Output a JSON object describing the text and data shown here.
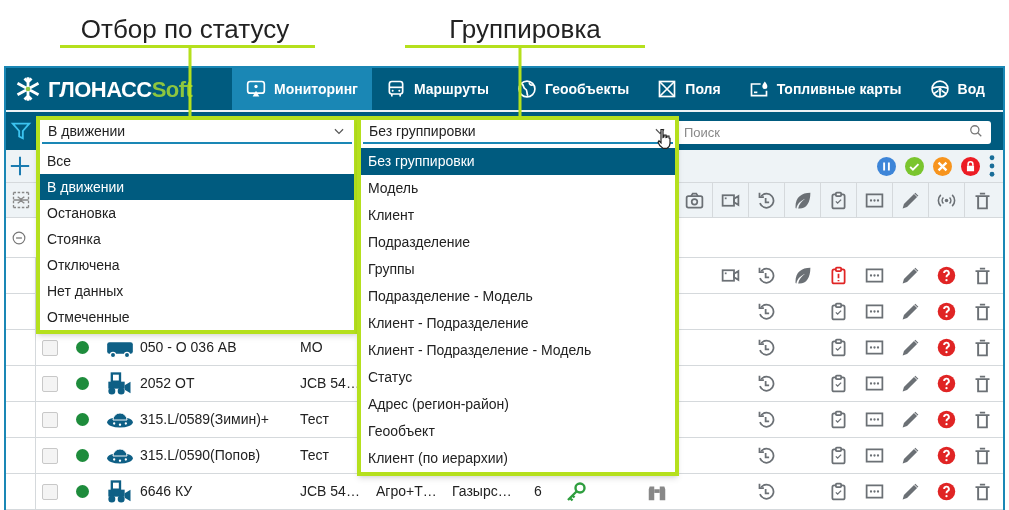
{
  "callouts": [
    {
      "text": "Отбор по статусу"
    },
    {
      "text": "Группировка"
    }
  ],
  "logo": {
    "main": "ГЛОНАСС",
    "accent": "Soft"
  },
  "nav": [
    {
      "label": "Мониторинг",
      "kind": "screen",
      "selected": true
    },
    {
      "label": "Маршруты",
      "kind": "bus",
      "selected": false
    },
    {
      "label": "Геообъекты",
      "kind": "globe",
      "selected": false
    },
    {
      "label": "Поля",
      "kind": "field",
      "selected": false
    },
    {
      "label": "Топливные карты",
      "kind": "fuel",
      "selected": false
    },
    {
      "label": "Вод",
      "kind": "wheel",
      "selected": false
    }
  ],
  "status_filter": {
    "value": "В движении",
    "options": [
      {
        "label": "Все",
        "selected": false
      },
      {
        "label": "В движении",
        "selected": true
      },
      {
        "label": "Остановка",
        "selected": false
      },
      {
        "label": "Стоянка",
        "selected": false
      },
      {
        "label": "Отключена",
        "selected": false
      },
      {
        "label": "Нет данных",
        "selected": false
      },
      {
        "label": "Отмеченные",
        "selected": false
      }
    ]
  },
  "grouping": {
    "value": "Без группировки",
    "options": [
      {
        "label": "Без группировки",
        "selected": true
      },
      {
        "label": "Модель",
        "selected": false
      },
      {
        "label": "Клиент",
        "selected": false
      },
      {
        "label": "Подразделение",
        "selected": false
      },
      {
        "label": "Группы",
        "selected": false
      },
      {
        "label": "Подразделение - Модель",
        "selected": false
      },
      {
        "label": "Клиент - Подразделение",
        "selected": false
      },
      {
        "label": "Клиент - Подразделение - Модель",
        "selected": false
      },
      {
        "label": "Статус",
        "selected": false
      },
      {
        "label": "Адрес (регион-район)",
        "selected": false
      },
      {
        "label": "Геообъект",
        "selected": false
      },
      {
        "label": "Клиент (по иерархии)",
        "selected": false
      }
    ]
  },
  "search": {
    "placeholder": "Поиск"
  },
  "rows": [
    {
      "actions": [
        {
          "kind": "video"
        },
        {
          "kind": "history"
        },
        {
          "kind": "leaf"
        },
        {
          "kind": "clipboard-alert"
        },
        {
          "kind": "more"
        },
        {
          "kind": "pencil"
        },
        {
          "kind": "question"
        },
        {
          "kind": "trash"
        }
      ]
    },
    {
      "actions": [
        {
          "kind": "history"
        },
        {
          "kind": "clipboard"
        },
        {
          "kind": "more"
        },
        {
          "kind": "pencil"
        },
        {
          "kind": "question"
        },
        {
          "kind": "trash"
        }
      ]
    },
    {
      "checked": false,
      "color": "#1e8c3c",
      "vehicle": {
        "kind": "bus"
      },
      "name": "050 - О 036 АВ",
      "model": "МО",
      "actions": [
        {
          "kind": "history"
        },
        {
          "kind": "clipboard"
        },
        {
          "kind": "more"
        },
        {
          "kind": "pencil"
        },
        {
          "kind": "question"
        },
        {
          "kind": "trash"
        }
      ]
    },
    {
      "checked": false,
      "color": "#1e8c3c",
      "vehicle": {
        "kind": "loader"
      },
      "name": "2052 ОТ",
      "model": "JCB 54…",
      "actions": [
        {
          "kind": "history"
        },
        {
          "kind": "clipboard"
        },
        {
          "kind": "more"
        },
        {
          "kind": "pencil"
        },
        {
          "kind": "question"
        },
        {
          "kind": "trash"
        }
      ]
    },
    {
      "checked": false,
      "color": "#1e8c3c",
      "vehicle": {
        "kind": "saucer"
      },
      "name": "315.L/0589(Зимин)+",
      "model": "Тест",
      "actions": [
        {
          "kind": "history"
        },
        {
          "kind": "clipboard"
        },
        {
          "kind": "more"
        },
        {
          "kind": "pencil"
        },
        {
          "kind": "question"
        },
        {
          "kind": "trash"
        }
      ]
    },
    {
      "checked": false,
      "color": "#1e8c3c",
      "vehicle": {
        "kind": "saucer"
      },
      "name": "315.L/0590(Попов)",
      "model": "Тест",
      "actions": [
        {
          "kind": "history"
        },
        {
          "kind": "clipboard"
        },
        {
          "kind": "more"
        },
        {
          "kind": "pencil"
        },
        {
          "kind": "question"
        },
        {
          "kind": "trash"
        }
      ]
    },
    {
      "checked": false,
      "color": "#1e8c3c",
      "vehicle": {
        "kind": "loader"
      },
      "name": "6646 КУ",
      "model": "JCB 54…",
      "client": "Агро+Т…",
      "department": "Газырс…",
      "count": "6",
      "extras": [
        {
          "kind": "key"
        },
        {
          "kind": "binoculars"
        }
      ],
      "actions": [
        {
          "kind": "history"
        },
        {
          "kind": "clipboard"
        },
        {
          "kind": "more"
        },
        {
          "kind": "pencil"
        },
        {
          "kind": "question"
        },
        {
          "kind": "trash"
        }
      ]
    }
  ]
}
